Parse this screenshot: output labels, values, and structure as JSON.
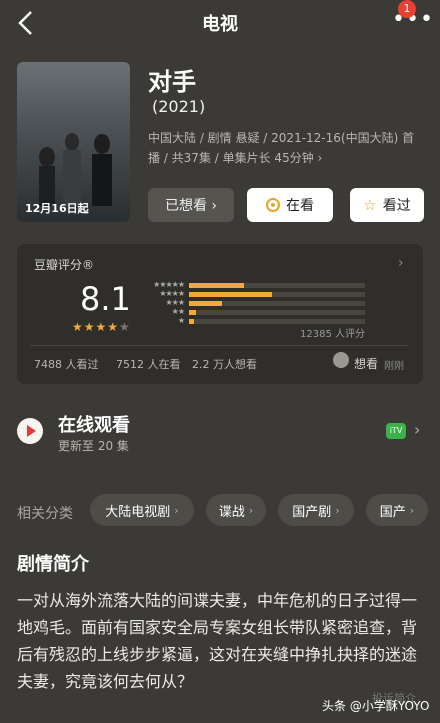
{
  "header": {
    "title": "电视",
    "notification_count": "1"
  },
  "show": {
    "title": "对手",
    "year": "(2021)",
    "poster_date": "12月16日起",
    "meta_line1": "中国大陆 / 剧情 悬疑 / 2021-12-16(中国大陆) 首",
    "meta_line2": "播 / 共37集 / 单集片长 45分钟 ›"
  },
  "actions": {
    "want": "已想看 ›",
    "watching": "在看",
    "watched": "看过"
  },
  "rating": {
    "header": "豆瓣评分®",
    "score": "8.1",
    "stars_filled": 4,
    "stars_total": 5,
    "distribution": [
      {
        "label": "★★★★★",
        "fraction": 0.31
      },
      {
        "label": "★★★★",
        "fraction": 0.47
      },
      {
        "label": "★★★",
        "fraction": 0.19
      },
      {
        "label": "★★",
        "fraction": 0.04
      },
      {
        "label": "★",
        "fraction": 0.03
      }
    ],
    "count_text": "12385 人评分",
    "watched_text": "7488 人看过",
    "watching_text": "7512 人在看",
    "want_text": "2.2 万人想看",
    "friend_want": "想看",
    "friend_time": "刚刚"
  },
  "online": {
    "title": "在线观看",
    "subtitle": "更新至 20 集",
    "platform": "iTV"
  },
  "categories": {
    "label": "相关分类",
    "tags": [
      "大陆电视剧",
      "谍战",
      "国产剧",
      "国产"
    ]
  },
  "synopsis": {
    "title": "剧情简介",
    "body": "一对从海外流落大陆的间谍夫妻，中年危机的日子过得一地鸡毛。面前有国家安全局专案女组长带队紧密追查，背后有残忍的上线步步紧逼，这对在夹缝中挣扎抉择的迷途夫妻，究竟该何去何从？",
    "more": "投诉简介",
    "watermark": "头条 @小学酥YOYO"
  }
}
